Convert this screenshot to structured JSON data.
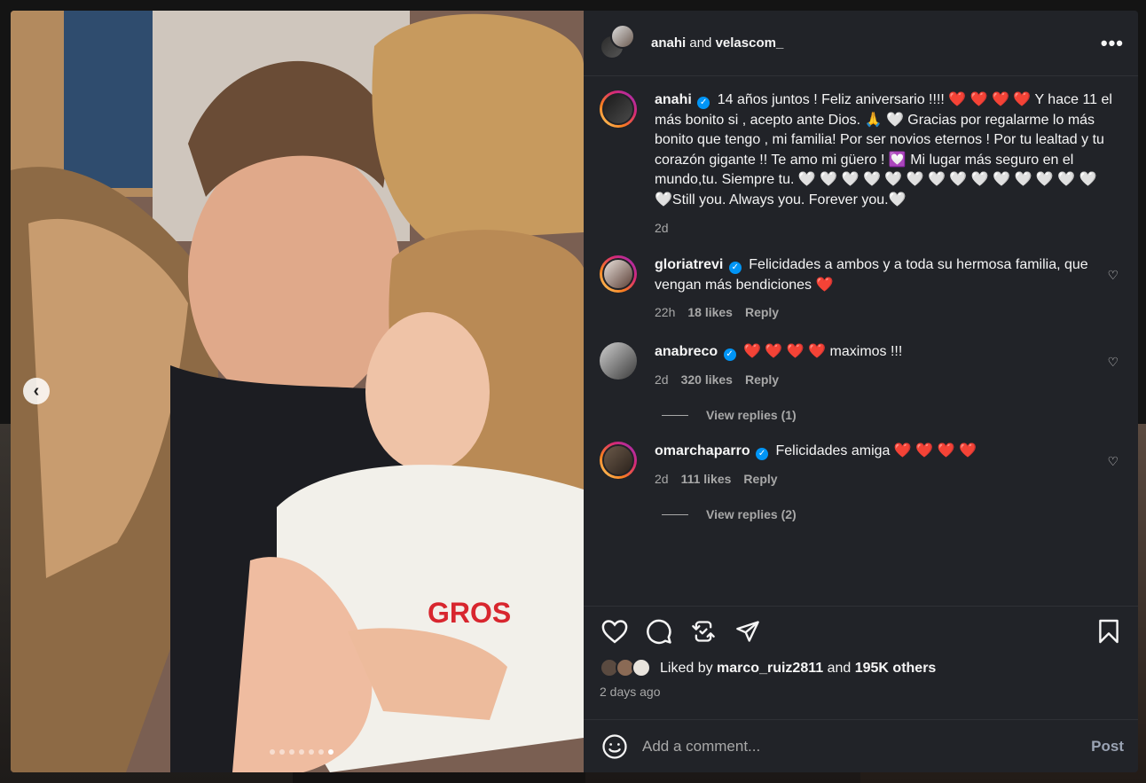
{
  "header": {
    "user1": "anahi",
    "joiner": "and",
    "user2": "velascom_",
    "more_label": "•••"
  },
  "media": {
    "prev_label": "‹",
    "slides_total": 7,
    "active_slide": 7,
    "shirt_text": "GROS"
  },
  "caption": {
    "username": "anahi",
    "text_a": "14 años juntos ! Feliz aniversario !!!! ",
    "hearts_a": "❤️ ❤️ ❤️ ❤️",
    "text_b": " Y hace 11 el más bonito si , acepto ante Dios. 🙏 🤍 Gracias por regalarme lo más bonito que tengo , mi familia! Por ser novios eternos ! Por tu lealtad y tu corazón gigante !! Te amo mi güero ! 💟 Mi lugar más seguro en el mundo,tu. Siempre tu. 🤍 🤍 🤍 🤍 🤍 🤍 🤍 🤍 🤍 🤍 🤍 🤍 🤍 🤍🤍Still you. Always you. Forever you.🤍",
    "time": "2d"
  },
  "comments": [
    {
      "username": "gloriatrevi",
      "text": "Felicidades a ambos y a toda su hermosa familia, que vengan más bendiciones ",
      "hearts": "❤️",
      "time": "22h",
      "likes": "18 likes",
      "reply": "Reply",
      "view_replies": ""
    },
    {
      "username": "anabreco",
      "text": " maximos !!!",
      "hearts": "❤️ ❤️ ❤️ ❤️",
      "time": "2d",
      "likes": "320 likes",
      "reply": "Reply",
      "view_replies": "View replies (1)"
    },
    {
      "username": "omarchaparro",
      "text": "Felicidades amiga ",
      "hearts": "❤️ ❤️ ❤️ ❤️",
      "time": "2d",
      "likes": "111 likes",
      "reply": "Reply",
      "view_replies": "View replies (2)"
    }
  ],
  "actions": {
    "liked_prefix": "Liked by",
    "liked_user": "marco_ruiz2811",
    "liked_and": "and",
    "liked_others": "195K others",
    "posted": "2 days ago"
  },
  "comment_box": {
    "placeholder": "Add a comment...",
    "post_label": "Post"
  },
  "colors": {
    "panel_bg": "#212328",
    "verified": "#0095f6",
    "heart": "#ef1a2c",
    "muted": "#a8a8a8"
  }
}
